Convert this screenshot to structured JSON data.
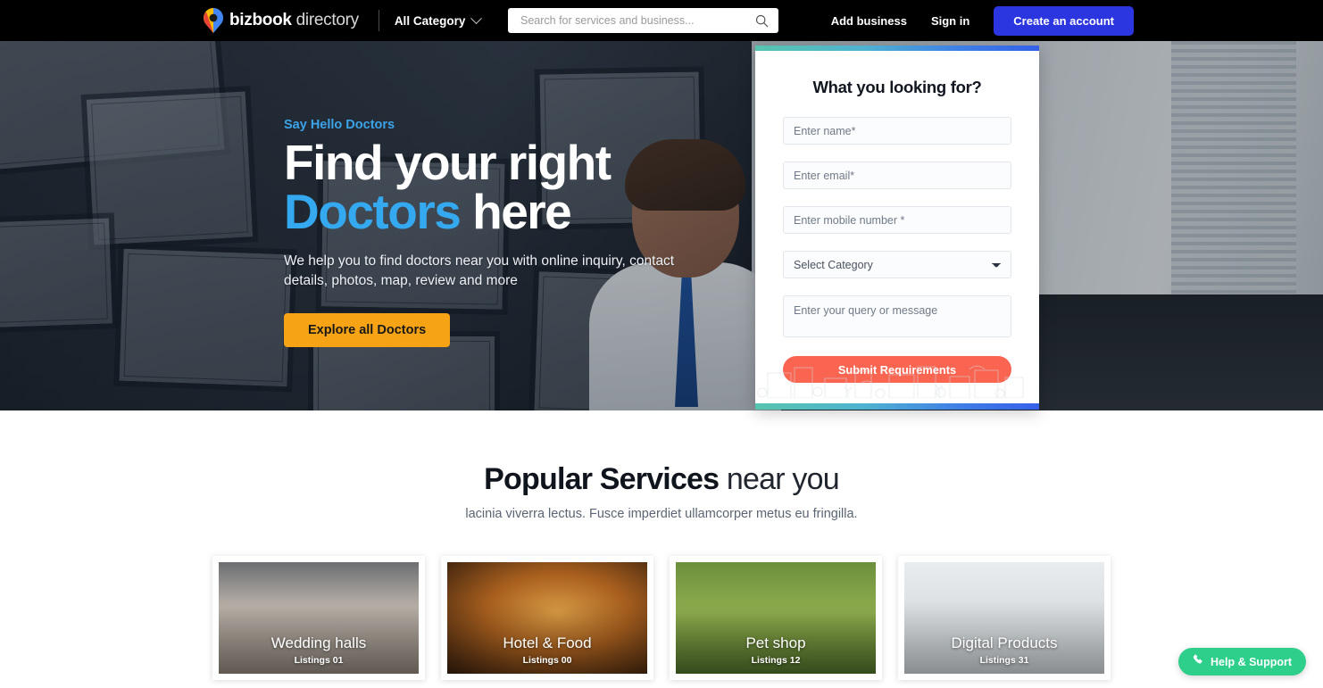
{
  "navbar": {
    "logo_icon": "map-pin-icon",
    "brand_bold": "bizbook",
    "brand_light": "directory",
    "category_label": "All Category",
    "category_chevron_icon": "chevron-down-icon",
    "search_placeholder": "Search for services and business...",
    "search_value": "",
    "search_icon": "search-icon",
    "add_business": "Add business",
    "sign_in": "Sign in",
    "create_account": "Create an account",
    "create_account_color": "#2b35e0"
  },
  "hero": {
    "eyebrow": "Say Hello Doctors",
    "headline_line1": "Find your right",
    "headline_accent": "Doctors",
    "headline_tail": " here",
    "accent_color": "#35a9ef",
    "subcopy": "We help you to find doctors near you with online inquiry, contact details, photos, map, review and more",
    "cta_label": "Explore all Doctors",
    "cta_color": "#f6a416"
  },
  "inquiry_panel": {
    "title": "What you looking for?",
    "name_placeholder": "Enter name*",
    "name_value": "",
    "email_placeholder": "Enter email*",
    "email_value": "",
    "mobile_placeholder": "Enter mobile number *",
    "mobile_value": "",
    "category_selected": "Select Category",
    "category_chevron_icon": "chevron-down-icon",
    "message_placeholder": "Enter your query or message",
    "message_value": "",
    "submit_label": "Submit Requirements",
    "submit_color": "#fa6552",
    "gradient_start": "#57c5ae",
    "gradient_end": "#3560e8"
  },
  "services": {
    "title_bold": "Popular Services",
    "title_light": " near you",
    "subtitle": "lacinia viverra lectus. Fusce imperdiet ullamcorper metus eu fringilla.",
    "cards": [
      {
        "name": "Wedding halls",
        "count": "Listings 01",
        "art": "art-wedding"
      },
      {
        "name": "Hotel & Food",
        "count": "Listings 00",
        "art": "art-food"
      },
      {
        "name": "Pet shop",
        "count": "Listings 12",
        "art": "art-pet"
      },
      {
        "name": "Digital Products",
        "count": "Listings 31",
        "art": "art-digital"
      }
    ]
  },
  "help_widget": {
    "label": "Help & Support",
    "icon": "phone-icon",
    "color": "#2dcf8a"
  }
}
